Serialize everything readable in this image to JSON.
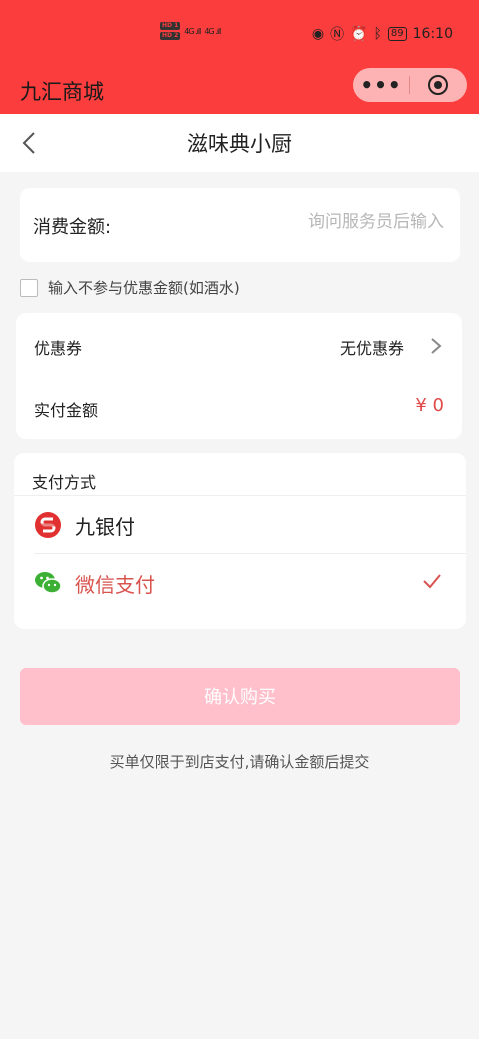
{
  "status_bar": {
    "hd1": "HD 1",
    "hd2": "HD 2",
    "signal1": "4G .ıll",
    "signal2": "4G .ıll",
    "battery": "89",
    "time": "16:10",
    "icons": [
      "eye-icon",
      "nfc-icon",
      "alarm-icon",
      "bluetooth-icon",
      "battery-icon"
    ]
  },
  "app": {
    "title": "九汇商城"
  },
  "capsule": {
    "more_label": "•••"
  },
  "page": {
    "title": "滋味典小厨"
  },
  "amount": {
    "label": "消费金额:",
    "placeholder": "询问服务员后输入",
    "value": ""
  },
  "exclude": {
    "label": "输入不参与优惠金额(如酒水)",
    "checked": false
  },
  "coupon": {
    "label": "优惠券",
    "value": "无优惠券"
  },
  "actual": {
    "label": "实付金额",
    "value": "¥ 0"
  },
  "payment": {
    "title": "支付方式",
    "methods": [
      {
        "name": "九银付",
        "selected": false,
        "color": "#222222"
      },
      {
        "name": "微信支付",
        "selected": true,
        "color": "#d9534f"
      }
    ]
  },
  "confirm": {
    "label": "确认购买"
  },
  "footnote": "买单仅限于到店支付,请确认金额后提交",
  "colors": {
    "brand_red": "#fb3d3d",
    "accent_red": "#e24a4a",
    "button_disabled": "#ffbfcb",
    "wechat_green": "#3cb034"
  }
}
